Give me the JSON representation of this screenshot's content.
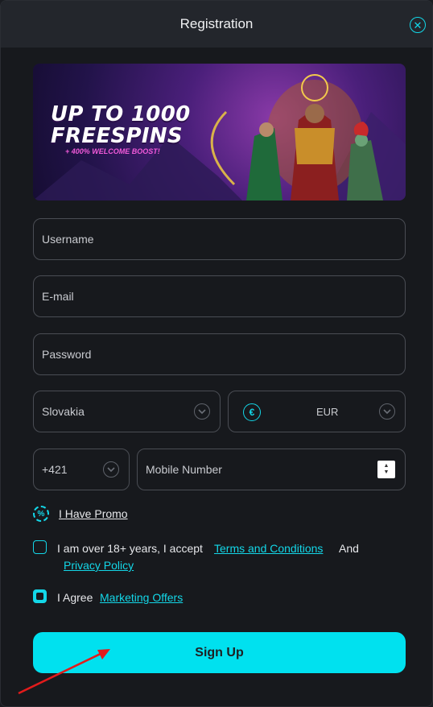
{
  "header": {
    "title": "Registration",
    "close_icon": "close-icon"
  },
  "banner": {
    "title": "UP TO 1000\nFREESPINS",
    "subtitle": "+ 400% WELCOME BOOST!"
  },
  "form": {
    "username_placeholder": "Username",
    "email_placeholder": "E-mail",
    "password_placeholder": "Password",
    "country": "Slovakia",
    "currency_symbol": "€",
    "currency": "EUR",
    "phone_code": "+421",
    "mobile_placeholder": "Mobile Number"
  },
  "promo": {
    "label": "I Have Promo"
  },
  "terms": {
    "text": "I am over 18+ years, I accept",
    "terms_link": "Terms and Conditions",
    "and": "And",
    "privacy_link": "Privacy Policy",
    "checked": false
  },
  "marketing": {
    "text": "I Agree",
    "link": "Marketing Offers",
    "checked": true
  },
  "signup": {
    "label": "Sign Up"
  },
  "colors": {
    "accent": "#13d7e8",
    "button": "#00e1ef",
    "annotation_arrow": "#e21b1b"
  }
}
